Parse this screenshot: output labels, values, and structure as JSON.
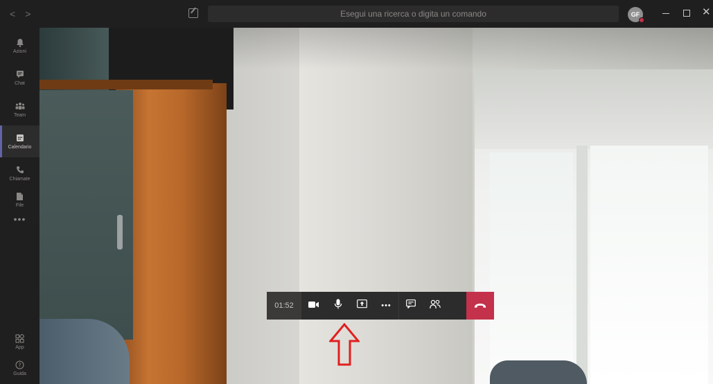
{
  "titlebar": {
    "search_placeholder": "Esegui una ricerca o digita un comando",
    "avatar_initials": "GF",
    "nav_back_icon": "chevron-left-icon",
    "nav_forward_icon": "chevron-right-icon"
  },
  "sidebar": {
    "items": [
      {
        "label": "Azioni",
        "icon": "bell-icon"
      },
      {
        "label": "Chat",
        "icon": "chat-icon"
      },
      {
        "label": "Team",
        "icon": "team-icon"
      },
      {
        "label": "Calendario",
        "icon": "calendar-icon",
        "active": true
      },
      {
        "label": "Chiamate",
        "icon": "phone-icon"
      },
      {
        "label": "File",
        "icon": "file-icon"
      }
    ],
    "more": "•••",
    "bottom": [
      {
        "label": "App",
        "icon": "apps-icon"
      },
      {
        "label": "Guida",
        "icon": "help-icon"
      }
    ]
  },
  "call_toolbar": {
    "timer": "01:52",
    "buttons": [
      "video-camera-icon",
      "microphone-icon",
      "share-screen-icon",
      "more-options-icon",
      "chat-icon",
      "participants-icon",
      "hang-up-icon"
    ],
    "more_label": "•••"
  },
  "colors": {
    "accent": "#6264a7",
    "hangup": "#c4314b",
    "annotation_arrow": "#e02020"
  }
}
